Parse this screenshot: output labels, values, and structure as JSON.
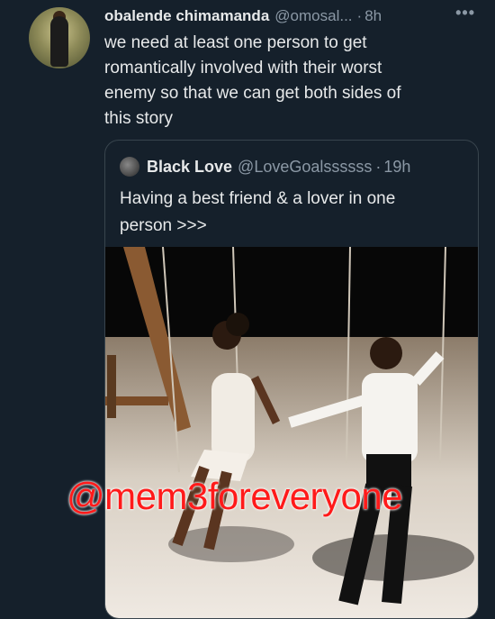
{
  "tweet": {
    "author_name": "obalende chimamanda",
    "author_handle": "@omosal...",
    "time": "8h",
    "more_icon": "more-horizontal-icon",
    "text_lines": [
      "we need at least one person to get",
      "romantically involved with their worst",
      "enemy so that we can get both sides  of",
      "this story"
    ]
  },
  "quote": {
    "author_name": "Black Love",
    "author_handle": "@LoveGoalssssss",
    "time": "19h",
    "text_lines": [
      "Having a best friend & a lover in one",
      "person >>>"
    ]
  },
  "watermark": "@mem3foreveryone",
  "colors": {
    "background": "#15202b",
    "text": "#e7e9ea",
    "muted": "#8b98a5",
    "border": "#38444d",
    "watermark": "#ff1a1a"
  }
}
